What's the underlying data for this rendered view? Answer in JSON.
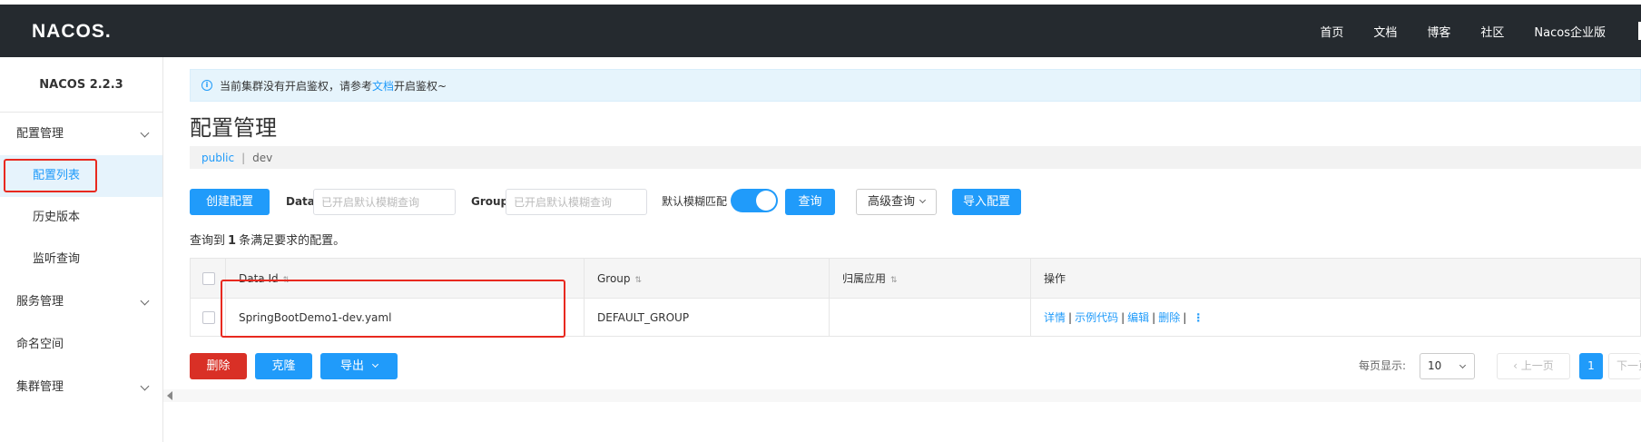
{
  "navbar": {
    "logo": "NACOS.",
    "links": [
      "首页",
      "文档",
      "博客",
      "社区",
      "Nacos企业版"
    ]
  },
  "sidebar": {
    "version": "NACOS 2.2.3",
    "groups": [
      {
        "label": "配置管理",
        "items": [
          "配置列表",
          "历史版本",
          "监听查询"
        ]
      },
      {
        "label": "服务管理"
      },
      {
        "label": "命名空间"
      },
      {
        "label": "集群管理"
      }
    ]
  },
  "notice": {
    "prefix": "当前集群没有开启鉴权，请参考",
    "link": "文档",
    "suffix": "开启鉴权~"
  },
  "page": {
    "title": "配置管理",
    "namespace": "public",
    "separator": "|",
    "namespace_id": "dev"
  },
  "toolbar": {
    "create_label": "创建配置",
    "dataid_label": "Data ID",
    "dataid_placeholder": "已开启默认模糊查询",
    "group_label": "Group",
    "group_placeholder": "已开启默认模糊查询",
    "fuzzy_label": "默认模糊匹配",
    "fuzzy_on": true,
    "query_label": "查询",
    "advanced_label": "高级查询",
    "import_label": "导入配置",
    "plus": "+"
  },
  "result": {
    "prefix": "查询到",
    "count": "1",
    "suffix": "条满足要求的配置。"
  },
  "table": {
    "headers": [
      "Data Id",
      "Group",
      "归属应用",
      "操作"
    ],
    "rows": [
      {
        "data_id": "SpringBootDemo1-dev.yaml",
        "group": "DEFAULT_GROUP",
        "app": "",
        "ops": [
          "详情",
          "示例代码",
          "编辑",
          "删除"
        ]
      }
    ]
  },
  "bottom": {
    "delete_label": "删除",
    "clone_label": "克隆",
    "export_label": "导出",
    "page_size_label": "每页显示:",
    "page_size": "10",
    "prev_label": "上一页",
    "current_page": "1",
    "next_label": "下一页"
  },
  "colors": {
    "primary": "#209bfa",
    "danger": "#d93026",
    "navbar": "#252a2f",
    "highlight": "#e8291f"
  }
}
